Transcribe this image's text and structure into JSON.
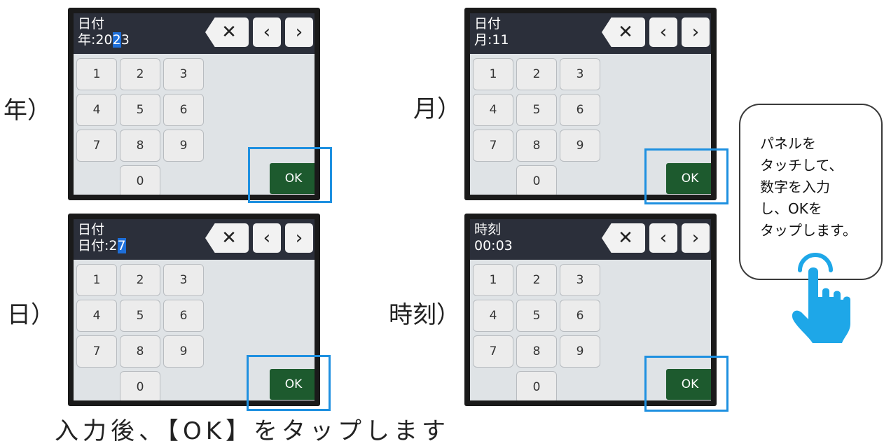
{
  "panels": [
    {
      "side_label": "年）",
      "title": "日付",
      "field_prefix": "年:20",
      "field_highlight": "2",
      "field_suffix": "3"
    },
    {
      "side_label": "月）",
      "title": "日付",
      "field_prefix": "月:11",
      "field_highlight": "",
      "field_suffix": ""
    },
    {
      "side_label": "日）",
      "title": "日付",
      "field_prefix": "日付:2",
      "field_highlight": "7",
      "field_suffix": ""
    },
    {
      "side_label": "時刻）",
      "title": "時刻",
      "field_prefix": "00:03",
      "field_highlight": "",
      "field_suffix": ""
    }
  ],
  "keypad": {
    "keys": [
      "1",
      "2",
      "3",
      "4",
      "5",
      "6",
      "7",
      "8",
      "9",
      "0"
    ],
    "delete_label": "✕",
    "prev_label": "‹",
    "next_label": "›",
    "ok_label": "OK"
  },
  "callout": {
    "lines": [
      "パネルを",
      "タッチして、",
      "数字を入力",
      "し、OKを",
      "タップします。"
    ]
  },
  "footer_text": "入力後、【OK】をタップします",
  "colors": {
    "highlight_frame": "#1e90e0",
    "ok_button": "#1d5a2e",
    "topbar": "#2b2f3a",
    "hand": "#1ea7e8"
  },
  "icons": {
    "pointer": "tap-hand-icon"
  }
}
